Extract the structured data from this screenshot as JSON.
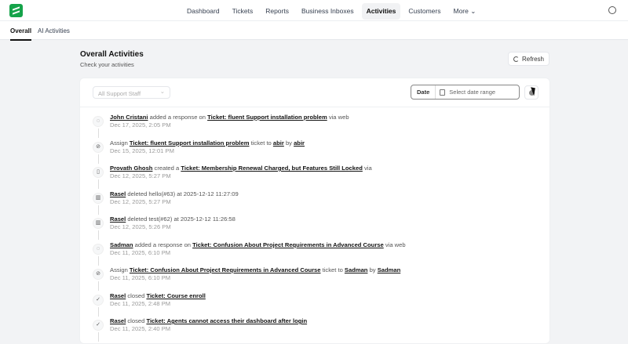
{
  "nav": {
    "items": [
      "Dashboard",
      "Tickets",
      "Reports",
      "Business Inboxes",
      "Activities",
      "Customers",
      "More ⌄"
    ],
    "active": "Activities"
  },
  "subtabs": [
    "Overall",
    "AI Activities"
  ],
  "header": {
    "title": "Overall Activities",
    "subtitle": "Check your activities",
    "refresh": "Refresh"
  },
  "filters": {
    "staff_placeholder": "All Support Staff",
    "date_label": "Date",
    "date_placeholder": "Select date range"
  },
  "activities": [
    {
      "icon": "chat-icon",
      "parts": [
        [
          "l",
          "John Cristani"
        ],
        [
          "t",
          " added a response on "
        ],
        [
          "l",
          "Ticket: fluent Support installation problem"
        ],
        [
          "t",
          " via web"
        ]
      ],
      "time": "Dec 17, 2025, 2:05 PM"
    },
    {
      "icon": "assign-icon",
      "parts": [
        [
          "t",
          "Assign "
        ],
        [
          "l",
          "Ticket: fluent Support installation problem"
        ],
        [
          "t",
          " ticket to "
        ],
        [
          "l",
          "abir"
        ],
        [
          "t",
          " by "
        ],
        [
          "l",
          "abir"
        ]
      ],
      "time": "Dec 15, 2025, 12:01 PM"
    },
    {
      "icon": "document-icon",
      "parts": [
        [
          "l",
          "Provath Ghosh"
        ],
        [
          "t",
          " created a "
        ],
        [
          "l",
          "Ticket: Membership Renewal Charged, but Features Still Locked"
        ],
        [
          "t",
          " via"
        ]
      ],
      "time": "Dec 12, 2025, 5:27 PM"
    },
    {
      "icon": "trash-icon",
      "parts": [
        [
          "l",
          "Rasel"
        ],
        [
          "t",
          " deleted hello(#63) at 2025-12-12 11:27:09"
        ]
      ],
      "time": "Dec 12, 2025, 5:27 PM"
    },
    {
      "icon": "trash-icon",
      "parts": [
        [
          "l",
          "Rasel"
        ],
        [
          "t",
          " deleted test(#62) at 2025-12-12 11:26:58"
        ]
      ],
      "time": "Dec 12, 2025, 5:26 PM"
    },
    {
      "icon": "chat-icon",
      "parts": [
        [
          "l",
          "Sadman"
        ],
        [
          "t",
          " added a response on "
        ],
        [
          "l",
          "Ticket: Confusion About Project Requirements in Advanced Course"
        ],
        [
          "t",
          " via web"
        ]
      ],
      "time": "Dec 11, 2025, 6:10 PM"
    },
    {
      "icon": "assign-icon",
      "parts": [
        [
          "t",
          "Assign "
        ],
        [
          "l",
          "Ticket: Confusion About Project Requirements in Advanced Course"
        ],
        [
          "t",
          " ticket to "
        ],
        [
          "l",
          "Sadman"
        ],
        [
          "t",
          " by "
        ],
        [
          "l",
          "Sadman"
        ]
      ],
      "time": "Dec 11, 2025, 6:10 PM"
    },
    {
      "icon": "check-circle-icon",
      "parts": [
        [
          "l",
          "Rasel"
        ],
        [
          "t",
          " closed "
        ],
        [
          "l",
          "Ticket: Course enroll"
        ]
      ],
      "time": "Dec 11, 2025, 2:48 PM"
    },
    {
      "icon": "check-circle-icon",
      "parts": [
        [
          "l",
          "Rasel"
        ],
        [
          "t",
          " closed "
        ],
        [
          "l",
          "Ticket: Agents cannot access their dashboard after login"
        ]
      ],
      "time": "Dec 11, 2025, 2:40 PM"
    }
  ]
}
